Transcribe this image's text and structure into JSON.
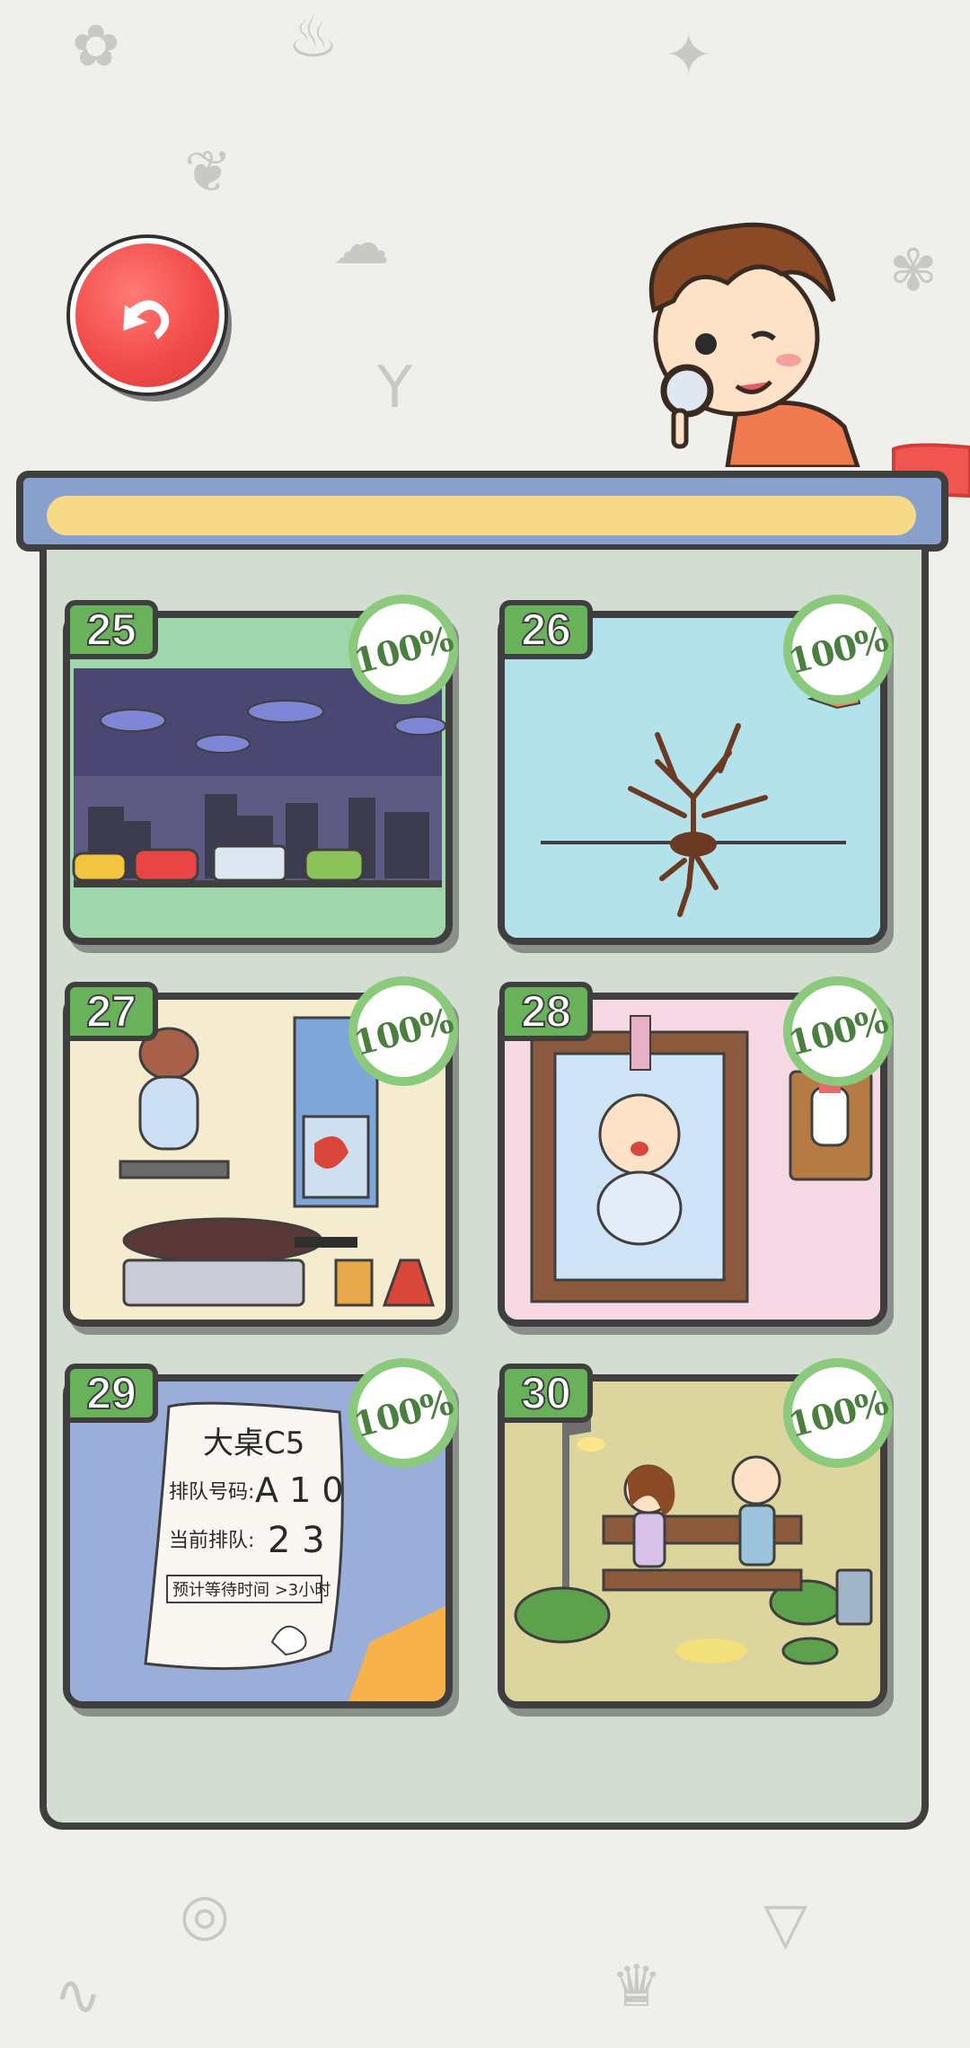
{
  "back_button": {
    "icon": "undo-arrow-icon"
  },
  "colors": {
    "tag_green": "#69b15b",
    "badge_ring": "#8bc97c",
    "frame": "#3f3f3f",
    "panel": "#d3ddd2"
  },
  "levels": [
    {
      "number": "25",
      "progress": "100%",
      "scene": "city-traffic-night",
      "bg": "#9fd6ac"
    },
    {
      "number": "26",
      "progress": "100%",
      "scene": "dry-tree-roots",
      "bg": "#b4e2ea"
    },
    {
      "number": "27",
      "progress": "100%",
      "scene": "pig-chef-kitchen",
      "bg": "#f5ebcf"
    },
    {
      "number": "28",
      "progress": "100%",
      "scene": "crying-baby-crib",
      "bg": "#f7d9e6"
    },
    {
      "number": "29",
      "progress": "100%",
      "scene": "queue-ticket",
      "bg": "#9baed9"
    },
    {
      "number": "30",
      "progress": "100%",
      "scene": "park-bench-couple",
      "bg": "#dcd59e"
    }
  ],
  "ticket": {
    "line1": "大桌C5",
    "line2_label": "排队号码:",
    "line2_value": "A 1 0",
    "line3_label": "当前排队:",
    "line3_value": "2 3",
    "line4": "预计等待时间 >3小时"
  }
}
